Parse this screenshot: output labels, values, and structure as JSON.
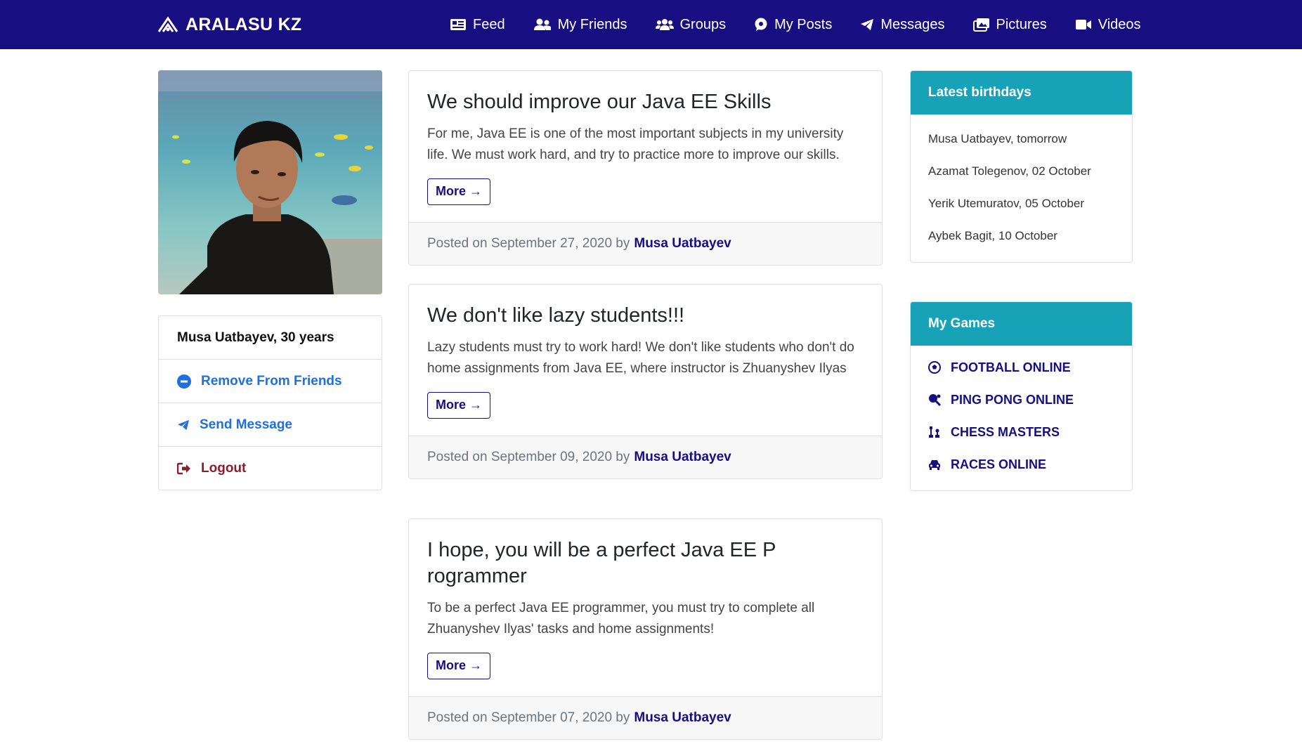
{
  "navbar": {
    "brand": "ARALASU KZ",
    "items": [
      {
        "label": "Feed",
        "icon": "newspaper-icon"
      },
      {
        "label": "My Friends",
        "icon": "user-friends-icon"
      },
      {
        "label": "Groups",
        "icon": "users-icon"
      },
      {
        "label": "My Posts",
        "icon": "comment-icon"
      },
      {
        "label": "Messages",
        "icon": "paper-plane-icon"
      },
      {
        "label": "Pictures",
        "icon": "images-icon"
      },
      {
        "label": "Videos",
        "icon": "video-icon"
      }
    ]
  },
  "profile": {
    "name_age": "Musa Uatbayev, 30 years",
    "actions": [
      {
        "label": "Remove From Friends",
        "icon": "minus-circle-icon",
        "color": "#1f6fdf"
      },
      {
        "label": "Send Message",
        "icon": "paper-plane-icon",
        "color": "#1f6fdf"
      },
      {
        "label": "Logout",
        "icon": "sign-out-icon",
        "color": "#8b1e2e"
      }
    ]
  },
  "posts": [
    {
      "title": "We should improve our Java EE Skills",
      "text": "For me, Java EE is one of the most important subjects in my university life. We must work hard, and try to practice more to improve our skills.",
      "more": "More →",
      "posted": "Posted on September 27, 2020 by",
      "author": "Musa Uatbayev"
    },
    {
      "title": "We don't like lazy students!!!",
      "text": "Lazy students must try to work hard! We don't like students who don't do home assignments from Java EE, where instructor is Zhuanyshev Ilyas",
      "more": "More →",
      "posted": "Posted on September 09, 2020 by",
      "author": "Musa Uatbayev"
    },
    {
      "title": "I hope, you will be a perfect Java EE P rogrammer",
      "text": "To be a perfect Java EE programmer, you must try to complete all Zhuanyshev Ilyas' tasks and home assignments!",
      "more": "More →",
      "posted": "Posted on September 07, 2020 by",
      "author": "Musa Uatbayev"
    }
  ],
  "birthdays": {
    "title": "Latest birthdays",
    "items": [
      "Musa Uatbayev, tomorrow",
      "Azamat Tolegenov, 02 October",
      "Yerik Utemuratov, 05 October",
      "Aybek Bagit, 10 October"
    ]
  },
  "games": {
    "title": "My Games",
    "items": [
      {
        "label": "FOOTBALL ONLINE",
        "icon": "futbol-icon"
      },
      {
        "label": "PING PONG ONLINE",
        "icon": "table-tennis-icon"
      },
      {
        "label": "CHESS MASTERS",
        "icon": "chess-icon"
      },
      {
        "label": "RACES ONLINE",
        "icon": "car-icon"
      }
    ]
  },
  "colors": {
    "navbar": "#170f81",
    "card_header": "#17a2b8",
    "link_blue": "#1f6fdf",
    "logout": "#8b1e2e"
  }
}
